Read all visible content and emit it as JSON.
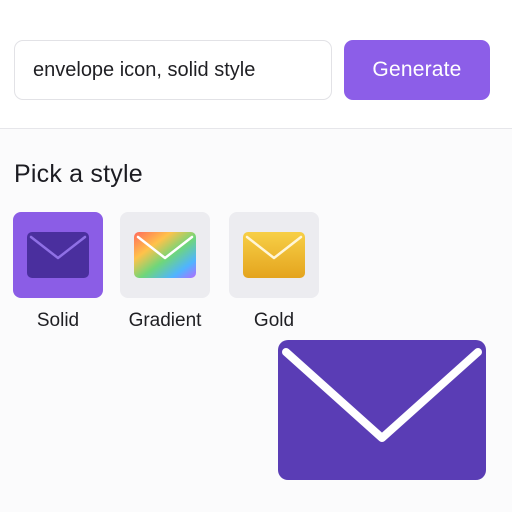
{
  "prompt": {
    "value": "envelope icon, solid style"
  },
  "generate_button": {
    "label": "Generate"
  },
  "style_picker": {
    "title": "Pick a style",
    "selected": "Solid",
    "options": [
      {
        "label": "Solid",
        "icon": "envelope-solid-icon"
      },
      {
        "label": "Gradient",
        "icon": "envelope-gradient-icon"
      },
      {
        "label": "Gold",
        "icon": "envelope-gold-icon"
      }
    ]
  },
  "preview": {
    "icon": "envelope-solid-icon"
  },
  "colors": {
    "accent": "#8c5ee8",
    "envelope_solid": "#5a3db5",
    "gold_light": "#f5c842",
    "gold_dark": "#e0a41c"
  }
}
